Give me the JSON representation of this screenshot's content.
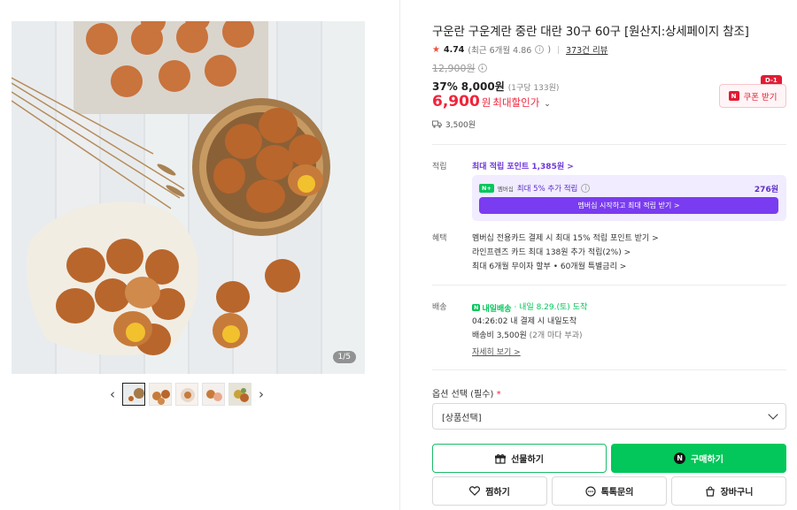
{
  "gallery": {
    "page_counter": "1/5",
    "prev_icon": "chevron-left-icon",
    "next_icon": "chevron-right-icon",
    "thumbnail_count": 5
  },
  "product": {
    "title": "구운란 구운계란 중란 대란 30구 60구 [원산지:상세페이지 참조]",
    "rating": "4.74",
    "rating_detail": "(최근 6개월 4.86",
    "rating_detail_close": ")",
    "reviews": "373건 리뷰",
    "original_price": "12,900원",
    "discount_rate": "37%",
    "sale_price": "8,000원",
    "unit_price": "(1구당 133원)",
    "best_price": "6,900",
    "best_price_unit": "원",
    "best_price_label": "최대할인가",
    "delivery_fee": "3,500원",
    "coupon_label": "쿠폰 받기",
    "coupon_badge": "D-1",
    "coupon_n": "N"
  },
  "points": {
    "label": "적립",
    "max_points": "최대 적립 포인트 1,385원 >",
    "member_tag": "멤버십",
    "member_extra": "최대 5% 추가 적립",
    "member_amount": "276원",
    "member_button": "멤버십 시작하고 최대 적립 받기 >"
  },
  "benefits": {
    "label": "혜택",
    "items": [
      "멤버십 전용카드 결제 시 최대 15% 적립 포인트 받기 >",
      "라인프렌즈 카드 최대 138원 추가 적립(2%) >",
      "최대 6개월 무이자 할부 • 60개월 특별금리 >"
    ]
  },
  "delivery": {
    "label": "배송",
    "tag": "내일배송",
    "arrival": "· 내일 8.29.(토) 도착",
    "countdown": "04:26:02",
    "countdown_text": "내 결제 시 내일도착",
    "fee_text": "배송비 3,500원",
    "fee_note": "(2개 마다 부과)",
    "detail_link": "자세히 보기 >"
  },
  "options": {
    "label": "옵션 선택 (필수)",
    "required_mark": "*",
    "select_value": "[상품선택]"
  },
  "actions": {
    "gift": "선물하기",
    "buy": "구매하기",
    "wish": "찜하기",
    "talk": "톡톡문의",
    "cart": "장바구니"
  },
  "colors": {
    "accent_green": "#03c75a",
    "price_red": "#f0243a",
    "membership_purple": "#7a3cf0"
  }
}
